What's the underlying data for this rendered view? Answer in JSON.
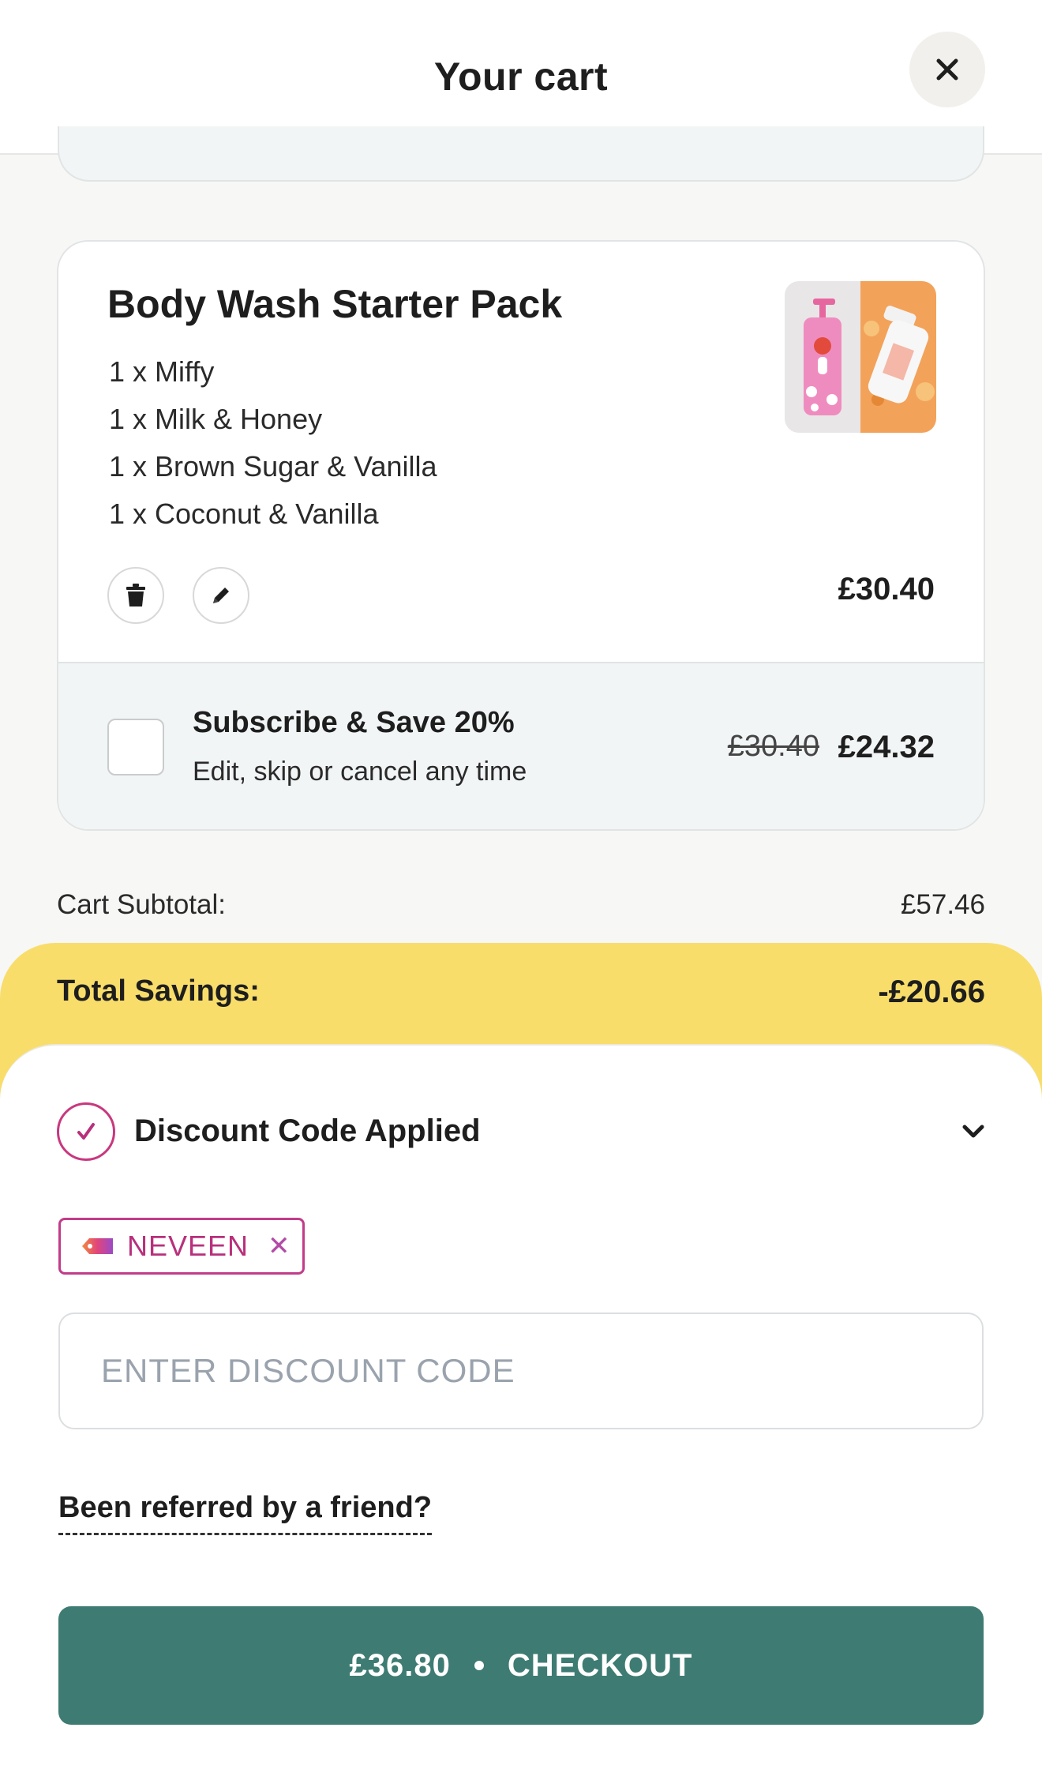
{
  "header": {
    "title": "Your cart"
  },
  "product": {
    "title": "Body Wash Starter Pack",
    "items": [
      "1 x Miffy",
      "1 x Milk & Honey",
      "1 x Brown Sugar & Vanilla",
      "1 x Coconut & Vanilla"
    ],
    "price": "£30.40",
    "subscribe": {
      "title": "Subscribe & Save 20%",
      "description": "Edit, skip or cancel any time",
      "old_price": "£30.40",
      "new_price": "£24.32"
    }
  },
  "summary": {
    "subtotal_label": "Cart Subtotal:",
    "subtotal_value": "£57.46",
    "savings_label": "Total Savings:",
    "savings_value": "-£20.66"
  },
  "discount": {
    "status_label": "Discount Code Applied",
    "applied_code": "NEVEEN",
    "input_placeholder": "ENTER DISCOUNT CODE",
    "referral_link": "Been referred by a friend?"
  },
  "checkout": {
    "amount": "£36.80",
    "label": "CHECKOUT"
  },
  "colors": {
    "accent": "#3e7b73",
    "savings_bg": "#f8dd6a",
    "code_pink": "#c23c8a"
  }
}
